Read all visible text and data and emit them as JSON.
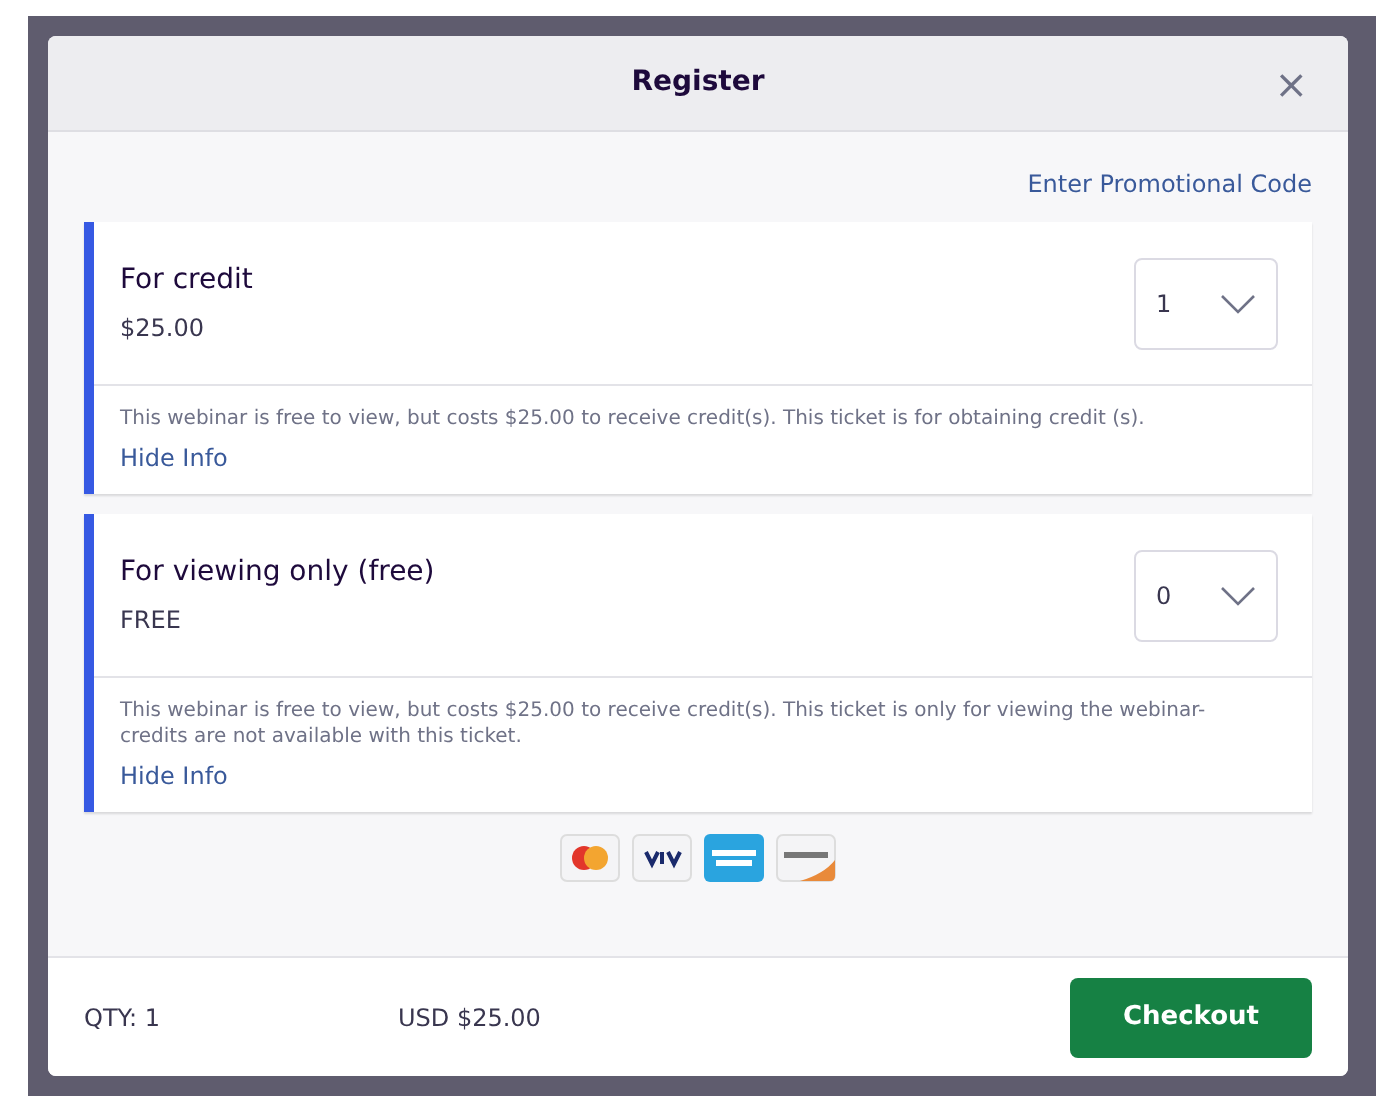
{
  "dialog": {
    "title": "Register",
    "close": "×"
  },
  "promo_link": "Enter Promotional Code",
  "tickets": [
    {
      "name": "For credit",
      "price": "$25.00",
      "quantity": "1",
      "description": "This webinar is free to view, but costs $25.00 to receive credit(s). This ticket is for obtaining credit (s).",
      "toggle": "Hide Info"
    },
    {
      "name": "For viewing only (free)",
      "price": "FREE",
      "quantity": "0",
      "description": "This webinar is free to view, but costs $25.00 to receive credit(s). This ticket is only for viewing the webinar- credits are not available with this ticket.",
      "toggle": "Hide Info"
    }
  ],
  "footer": {
    "quantity": "QTY: 1",
    "total": "USD $25.00",
    "checkout": "Checkout"
  }
}
